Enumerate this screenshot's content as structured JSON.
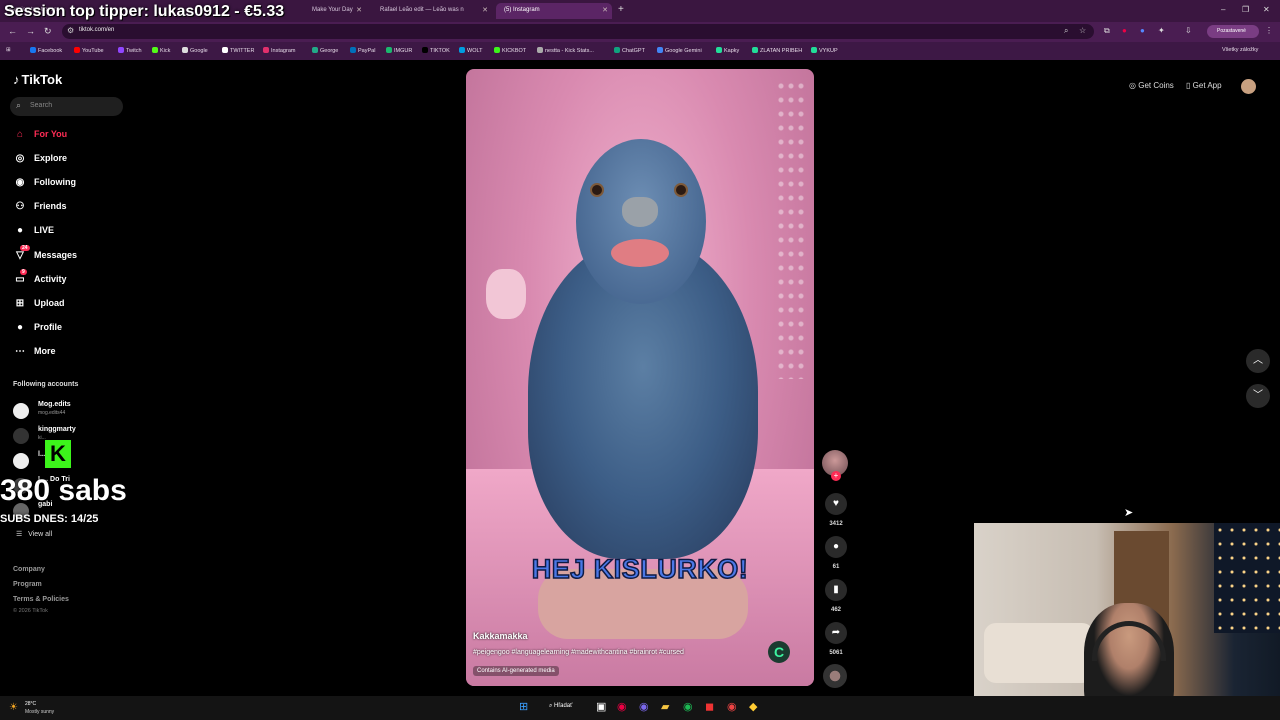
{
  "browser": {
    "tabs": [
      {
        "title": "Session top tipper...",
        "active": false
      },
      {
        "title": "Make Your Day",
        "active": false
      },
      {
        "title": "Rafael Leão edit — Leão was n",
        "active": false
      },
      {
        "title": "(5) Instagram",
        "active": true
      }
    ],
    "url": "tiktok.com/en",
    "profile_label": "Pozastavené",
    "bookmarks": [
      "Facebook",
      "YouTube",
      "Twitch",
      "Kick",
      "Google",
      "TWITTER",
      "Instagram",
      "George",
      "PayPal",
      "IMGUR",
      "TIKTOK",
      "WOLT",
      "KICKBOT",
      "nestta - Kick Stats...",
      "ChatGPT",
      "Google Gemini",
      "Kapky",
      "ZLATAN PRIBEH",
      "VYKUP"
    ],
    "bookmarks_right": "Všetky záložky"
  },
  "overlay": {
    "top_tipper": "Session top tipper: lukas0912 - €5.33",
    "sabs": "380 sabs",
    "subs_goal": "SUBS DNES: 14/25"
  },
  "sidebar": {
    "logo": "TikTok",
    "search_placeholder": "Search",
    "nav": [
      {
        "label": "For You",
        "icon": "home-icon"
      },
      {
        "label": "Explore",
        "icon": "compass-icon"
      },
      {
        "label": "Following",
        "icon": "following-icon"
      },
      {
        "label": "Friends",
        "icon": "friends-icon"
      },
      {
        "label": "LIVE",
        "icon": "live-icon"
      },
      {
        "label": "Messages",
        "icon": "messages-icon",
        "badge": "24"
      },
      {
        "label": "Activity",
        "icon": "activity-icon",
        "badge": "9"
      },
      {
        "label": "Upload",
        "icon": "upload-icon"
      },
      {
        "label": "Profile",
        "icon": "profile-icon"
      },
      {
        "label": "More",
        "icon": "more-icon"
      }
    ],
    "following_title": "Following accounts",
    "accounts": [
      {
        "name": "Mog.edits",
        "handle": "mog.edits44"
      },
      {
        "name": "kinggmarty",
        "handle": "ki..."
      },
      {
        "name": "l...",
        "handle": ""
      },
      {
        "name": "L... Do Tri",
        "handle": ""
      },
      {
        "name": "gabi",
        "handle": ""
      }
    ],
    "view_all": "View all",
    "footer": [
      "Company",
      "Program",
      "Terms & Policies"
    ],
    "copyright": "© 2026 TikTok"
  },
  "video": {
    "caption": "HEJ KISLURKO!",
    "author": "Kakkamakka",
    "hashtags": "#peigengoo #languagelearning #madewithcantina #brainrot #cursed",
    "ai_label": "Contains AI-generated media"
  },
  "actions": {
    "likes": "3412",
    "comments": "61",
    "saves": "462",
    "shares": "5061"
  },
  "header_right": {
    "get_coins": "Get Coins",
    "get_app": "Get App"
  },
  "taskbar": {
    "temp": "28°C",
    "weather": "Mostly sunny",
    "search": "Hľadať"
  },
  "colors": {
    "accent": "#fe2c55",
    "browser_bg": "#3a1640",
    "kick_green": "#3cf51b"
  }
}
